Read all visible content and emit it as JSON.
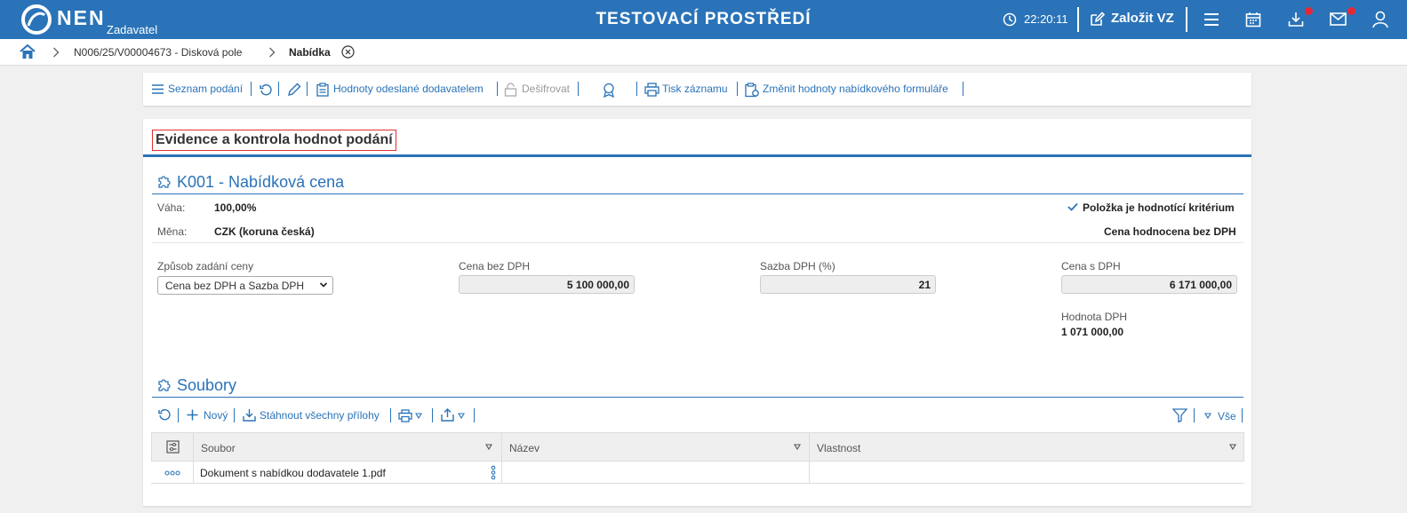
{
  "topbar": {
    "logo": "NEN",
    "logo_sub": "Zadavatel",
    "environment": "TESTOVACÍ PROSTŘEDÍ",
    "clock": "22:20:11",
    "create_label": "Založit VZ",
    "brand_color": "#2a73b8",
    "notification_color": "#e62836",
    "icons": [
      "clock-icon",
      "edit-icon",
      "menu-icon",
      "calendar-icon",
      "download-icon",
      "mail-icon",
      "user-icon"
    ]
  },
  "breadcrumb": {
    "items": [
      "N006/25/V00004673 - Disková pole",
      "Nabídka"
    ]
  },
  "toolbar": {
    "list_label": "Seznam podání",
    "sent_values_label": "Hodnoty odeslané dodavatelem",
    "decrypt_label": "Dešifrovat",
    "print_label": "Tisk záznamu",
    "change_values_label": "Změnit hodnoty nabídkového formuláře"
  },
  "page": {
    "title": "Evidence a kontrola hodnot podání"
  },
  "criterion": {
    "title": "K001 - Nabídková cena",
    "weight_label": "Váha:",
    "weight_value": "100,00%",
    "currency_label": "Měna:",
    "currency_value": "CZK (koruna česká)",
    "flag_criterion": "Položka je hodnotící kritérium",
    "flag_evaluation": "Cena hodnocena bez DPH",
    "method_label": "Způsob zadání ceny",
    "method_value": "Cena bez DPH a Sazba DPH",
    "price_no_vat_label": "Cena bez DPH",
    "price_no_vat_value": "5 100 000,00",
    "vat_rate_label": "Sazba DPH (%)",
    "vat_rate_value": "21",
    "price_vat_label": "Cena s DPH",
    "price_vat_value": "6 171 000,00",
    "vat_amount_label": "Hodnota DPH",
    "vat_amount_value": "1 071 000,00"
  },
  "files": {
    "title": "Soubory",
    "new_label": "Nový",
    "download_all_label": "Stáhnout všechny přílohy",
    "filter_all_label": "Vše",
    "columns": [
      "Soubor",
      "Název",
      "Vlastnost"
    ],
    "rows": [
      {
        "soubor": "Dokument s nabídkou dodavatele 1.pdf",
        "nazev": "",
        "vlastnost": ""
      }
    ]
  }
}
